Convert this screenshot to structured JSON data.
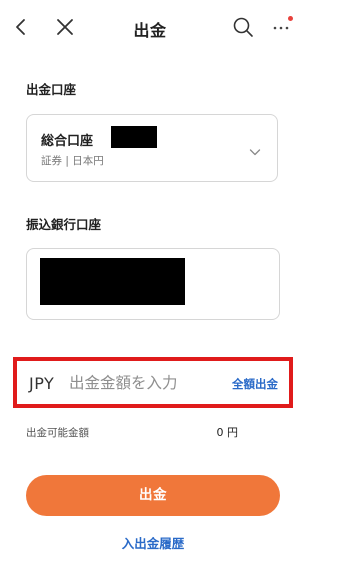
{
  "header": {
    "title": "出金",
    "left_icons": [
      "back-icon",
      "close-icon"
    ],
    "right_icons": [
      "search-icon",
      "more-icon"
    ],
    "notification_dot": true
  },
  "account_section": {
    "title": "出金口座",
    "selected_account": "総合口座",
    "sub_text": "証券 | 日本円"
  },
  "bank_section": {
    "title": "振込銀行口座"
  },
  "amount": {
    "currency": "JPY",
    "placeholder": "出金金額を入力",
    "withdraw_all_label": "全額出金"
  },
  "available": {
    "label": "出金可能金額",
    "value": "0 円"
  },
  "actions": {
    "withdraw_button": "出金",
    "history_link": "入出金履歴"
  },
  "colors": {
    "accent": "#f0773a",
    "link": "#2a6ac8",
    "highlight_border": "#e01b1b",
    "notification": "#e8413c"
  }
}
